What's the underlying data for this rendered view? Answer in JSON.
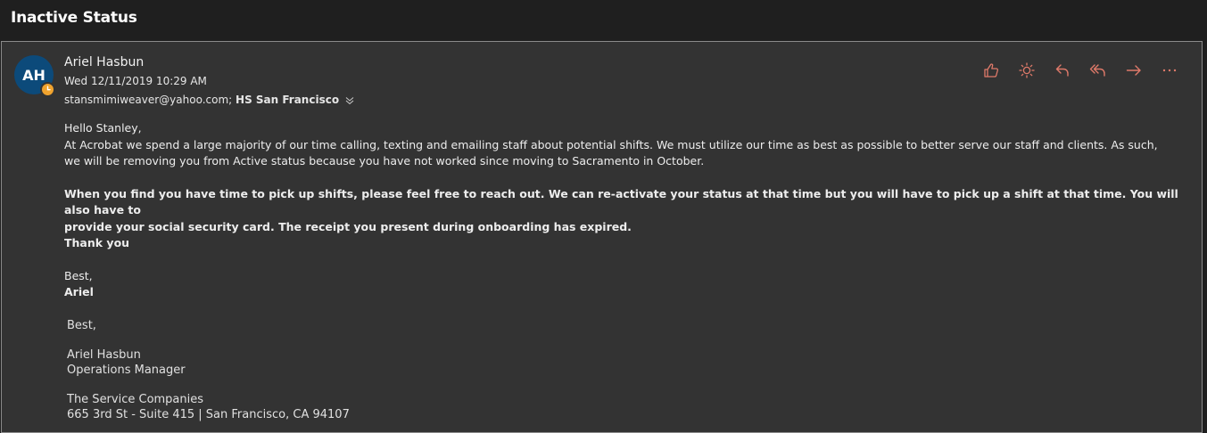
{
  "header": {
    "subject": "Inactive Status"
  },
  "message": {
    "avatar_initials": "AH",
    "sender": "Ariel Hasbun",
    "date": "Wed 12/11/2019 10:29 AM",
    "recipient_1": "stansmimiweaver@yahoo.com;",
    "recipient_2": "HS San Francisco"
  },
  "toolbar": {
    "icons": [
      "like-icon",
      "sun-icon",
      "reply-icon",
      "reply-all-icon",
      "forward-icon",
      "more-icon"
    ],
    "accent_color": "#e07a6a"
  },
  "body": {
    "greeting": "Hello Stanley,",
    "para1_line1": "At Acrobat we spend a large majority of our time calling, texting and emailing staff about potential shifts. We must utilize our time as best as possible to better serve our staff and clients.  As such,",
    "para1_line2": "we will be removing you from Active status because you have not worked since moving to Sacramento in October.",
    "para2_line1": "When you find you have time to pick up shifts, please feel free to reach out. We can re-activate your status at that time but you will have to pick up a shift at that time.  You will also have to",
    "para2_line2": "provide your social security card. The receipt you present during onboarding has expired.",
    "thanks": "Thank you",
    "closing": "Best,",
    "closing_name": "Ariel"
  },
  "signature": {
    "best": "Best,",
    "name": "Ariel Hasbun",
    "title": "Operations Manager",
    "company": "The Service Companies",
    "address": "665 3rd St - Suite 415 | San Francisco, CA 94107"
  }
}
